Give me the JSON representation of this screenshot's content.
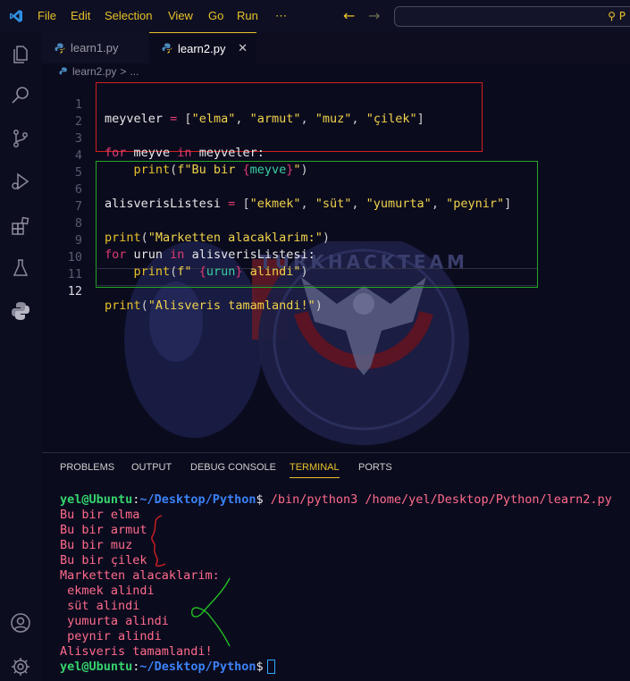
{
  "menu": {
    "items": [
      "File",
      "Edit",
      "Selection",
      "View",
      "Go",
      "Run",
      "⋯"
    ]
  },
  "search": {
    "text": "P"
  },
  "icons": {
    "activity": [
      "files-icon",
      "search-icon",
      "source-control-icon",
      "run-debug-icon",
      "extensions-icon",
      "testing-icon",
      "python-icon",
      "account-icon",
      "settings-gear-icon"
    ]
  },
  "tabs": [
    {
      "label": "learn1.py"
    },
    {
      "label": "learn2.py"
    }
  ],
  "breadcrumb": {
    "file": "learn2.py",
    "sep": ">",
    "more": "..."
  },
  "editor": {
    "active_line": 12,
    "lines": [
      {
        "n": "1"
      },
      {
        "n": "2"
      },
      {
        "n": "3"
      },
      {
        "n": "4"
      },
      {
        "n": "5"
      },
      {
        "n": "6"
      },
      {
        "n": "7"
      },
      {
        "n": "8"
      },
      {
        "n": "9"
      },
      {
        "n": "10"
      },
      {
        "n": "11"
      },
      {
        "n": "12"
      }
    ],
    "code": {
      "l1": {
        "a": "meyveler",
        "b": " = ",
        "c": "[",
        "d": "\"elma\"",
        "e": ", ",
        "f": "\"armut\"",
        "g": ", ",
        "h": "\"muz\"",
        "i": ", ",
        "j": "\"çilek\"",
        "k": "]"
      },
      "l3": {
        "a": "for",
        "b": " meyve ",
        "c": "in",
        "d": " meyveler:"
      },
      "l4": {
        "a": "    ",
        "b": "print",
        "c": "(",
        "d": "f\"Bu bir ",
        "e": "{",
        "f": "meyve",
        "g": "}",
        "h": "\"",
        "i": ")"
      },
      "l6": {
        "a": "alisverisListesi",
        "b": " = ",
        "c": "[",
        "d": "\"ekmek\"",
        "e": ", ",
        "f": "\"süt\"",
        "g": ", ",
        "h": "\"yumurta\"",
        "i": ", ",
        "j": "\"peynir\"",
        "k": "]"
      },
      "l8": {
        "a": "print",
        "b": "(",
        "c": "\"Marketten alacaklarim:\"",
        "d": ")"
      },
      "l9": {
        "a": "for",
        "b": " urun ",
        "c": "in",
        "d": " alisverisListesi:"
      },
      "l10": {
        "a": "    ",
        "b": "print",
        "c": "(",
        "d": "f\" ",
        "e": "{",
        "f": "urun",
        "g": "}",
        "h": " alindi\"",
        "i": ")"
      },
      "l12": {
        "a": "print",
        "b": "(",
        "c": "\"Alisveris tamamlandi!\"",
        "d": ")"
      }
    }
  },
  "watermark": {
    "text": "TURKHACKTEAM"
  },
  "panel": {
    "tabs": [
      "PROBLEMS",
      "OUTPUT",
      "DEBUG CONSOLE",
      "TERMINAL",
      "PORTS"
    ],
    "active_tab": "TERMINAL"
  },
  "terminal": {
    "prompt_user": "yel@Ubuntu",
    "prompt_colon": ":",
    "prompt_path": "~/Desktop/Python",
    "prompt_dollar": "$",
    "command": " /bin/python3 /home/yel/Desktop/Python/learn2.py",
    "output": [
      "Bu bir elma",
      "Bu bir armut",
      "Bu bir muz",
      "Bu bir çilek",
      "Marketten alacaklarim:",
      " ekmek alindi",
      " süt alindi",
      " yumurta alindi",
      " peynir alindi",
      "Alisveris tamamlandi!"
    ]
  },
  "colors": {
    "accent": "#e6c229",
    "keyword": "#e03b6f",
    "string": "#f0d34a",
    "variable": "#39d0a0",
    "prompt_user": "#35d46d",
    "prompt_path": "#3b82f6",
    "terminal_text": "#ff6b8a",
    "annotation_red": "#d02020",
    "annotation_green": "#22a822"
  }
}
